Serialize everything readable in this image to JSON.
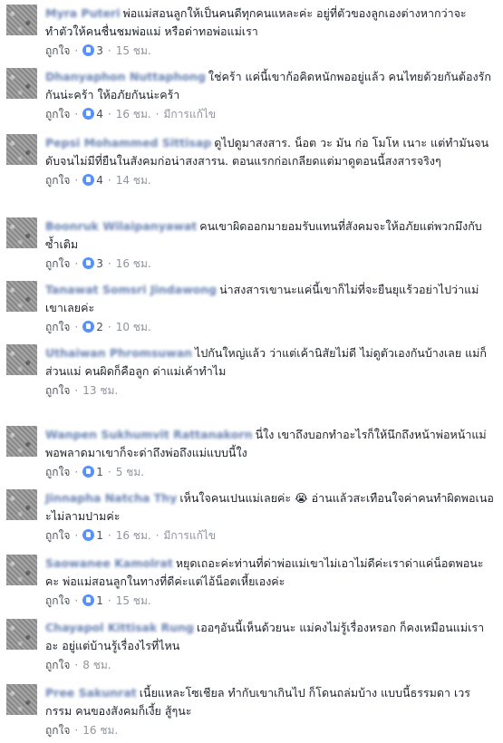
{
  "like_label": "ถูกใจ",
  "edited_label": "มีการแก้ไข",
  "comments": [
    {
      "name": "Myra Puteri",
      "text": "พ่อแม่สอนลูกให้เป็นคนดีทุกคนแหละค่ะ อยู่ที่ตัวของลูกเองต่างหากว่าจะทำตัวให้คนชื่นชมพ่อแม่ หรือด่าทอพ่อแม่เรา",
      "reactions": "3",
      "time": "15 ชม.",
      "edited": ""
    },
    {
      "name": "Dhanyaphon Nuttaphong",
      "text": "ใช่คร้า แค่นี้เขาก้อคิดหนักพออยู่แล้ว คนไทยด้วยกันต้องรักกันน่ะคร้า ให้อภัยกันน่ะคร้า",
      "reactions": "4",
      "time": "16 ชม.",
      "edited": "มีการแก้ไข"
    },
    {
      "name": "Pepsi Mohammed Sittisap",
      "text": "ดูไปดูมาสงสาร. น็อต วะ มัน ก่อ โมโห เนาะ แต่ทำมันจนดับจนไม่มีที่ยืนในสังคมก่อน่าสงสารน. ตอนแรกก่อเกลียดแต่มาดูตอนนี้สงสารจริงๆ",
      "reactions": "4",
      "time": "14 ชม.",
      "edited": ""
    },
    {
      "name": "Boonruk Wilaipanyawat",
      "text": "คนเขาผิดออกมายอมรับแทนที่สังคมจะให้อภัยแต่พวกมึงกับซ้ำเติม",
      "reactions": "3",
      "time": "16 ชม.",
      "edited": ""
    },
    {
      "name": "Tanawat Somsri Jindawong",
      "text": "น่าสงสารเขานะแค่นี้เขาก็ไม่ที่จะยืนยุแร้วอย่าไปว่าแม่เขาเลยค่ะ",
      "reactions": "2",
      "time": "10 ชม.",
      "edited": ""
    },
    {
      "name": "Uthaiwan Phromsuwan",
      "text": "ไปกันใหญ่แล้ว ว่าแต่เค้านิสัยไม่ดี ไม่ดูตัวเองกันบ้างเลย แม่ก็ส่วนแม่ คนผิดก็คือลูก ด่าแม่เค้าทำไม",
      "reactions": "",
      "time": "13 ชม.",
      "edited": ""
    },
    {
      "name": "Wanpen Sukhumvit Rattanakorn",
      "text": "นี่ใง เขาถึงบอกทำอะไรก็ให้นึกถึงหน้าพ่อหน้าแม่ พอพลาดมาเขาก็จะด่าถึงพ่อถึงแม่แบบนี้ใง",
      "reactions": "1",
      "time": "5 ชม.",
      "edited": ""
    },
    {
      "name": "Jinnapha Natcha Thy",
      "text": "เห็นใจคนเปนแม่เลยค่ะ 😭 อ่านแล้วสะเทือนใจค่าคนทำผิดพอเนอะไม่ลามปามค่ะ",
      "reactions": "1",
      "time": "16 ชม.",
      "edited": "มีการแก้ไข"
    },
    {
      "name": "Saowanee Kamolrat",
      "text": "หยุดเถอะค่ะท่านที่ด่าพ่อแม่เขาไม่เอาไม่ดีค่ะเราด่าแค่น็อตพอนะคะ พ่อแม่สอนลูกในทางที่ดีค่ะแต่ไอ้น็อตเหี้ยเองค่ะ",
      "reactions": "1",
      "time": "15 ชม.",
      "edited": ""
    },
    {
      "name": "Chayapol Kittisak Rung",
      "text": "เออๆอันนี้เห็นด้วยนะ แม่คงไม่รู้เรื่องหรอก ก็คงเหมือนแม่เราอะ อยู่แต่บ้านรู้เรื่องไรที่ไหน",
      "reactions": "",
      "time": "8 ชม.",
      "edited": ""
    },
    {
      "name": "Pree Sakunrat",
      "text": "เนี้ยแหละโซเชียล ทำกับเขาเกินไป ก็โดนถล่มบ้าง แบบนี้ธรรมดา เวรกรรม คนของสังคมก็เงี้ย สู้ๆนะ",
      "reactions": "",
      "time": "16 ชม.",
      "edited": ""
    }
  ]
}
